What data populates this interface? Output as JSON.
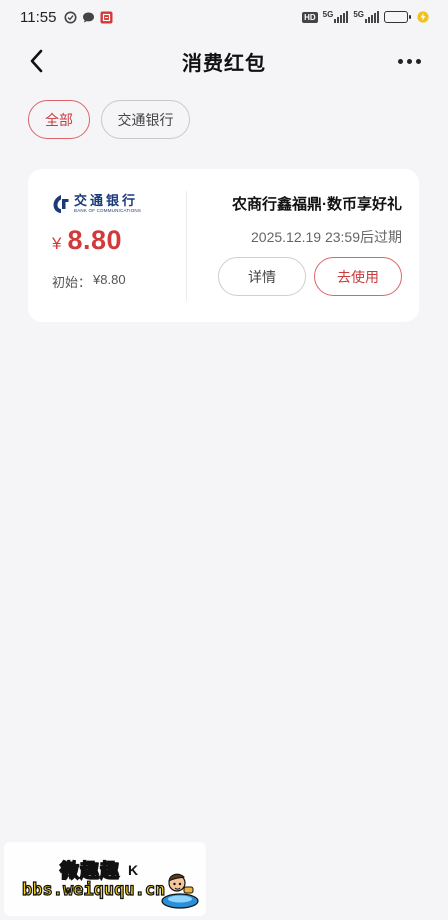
{
  "status_bar": {
    "time": "11:55",
    "hd_label": "HD",
    "signal_1_label": "5G",
    "signal_2_label": "5G",
    "battery_color": "#31c24a"
  },
  "nav": {
    "title": "消费红包",
    "back_icon": "chevron-left-icon",
    "more_icon": "more-horizontal-icon"
  },
  "filters": [
    {
      "label": "全部",
      "active": true
    },
    {
      "label": "交通银行",
      "active": false
    }
  ],
  "card": {
    "bank_logo_cn": "交通银行",
    "bank_logo_en": "BANK OF COMMUNICATIONS",
    "currency_symbol": "¥",
    "amount": "8.80",
    "initial_label": "初始：",
    "initial_value": "¥8.80",
    "title": "农商行鑫福鼎·数币享好礼",
    "expiry": "2025.12.19 23:59后过期",
    "detail_button": "详情",
    "use_button": "去使用"
  },
  "watermark": {
    "title": "微趣趣",
    "url": "bbs.weiququ.cn",
    "mark": "K"
  },
  "colors": {
    "accent": "#d23a3a",
    "accent_border": "#d9666a",
    "background": "#f5f5f8",
    "card": "#ffffff",
    "bank_blue": "#1a3a7a"
  }
}
